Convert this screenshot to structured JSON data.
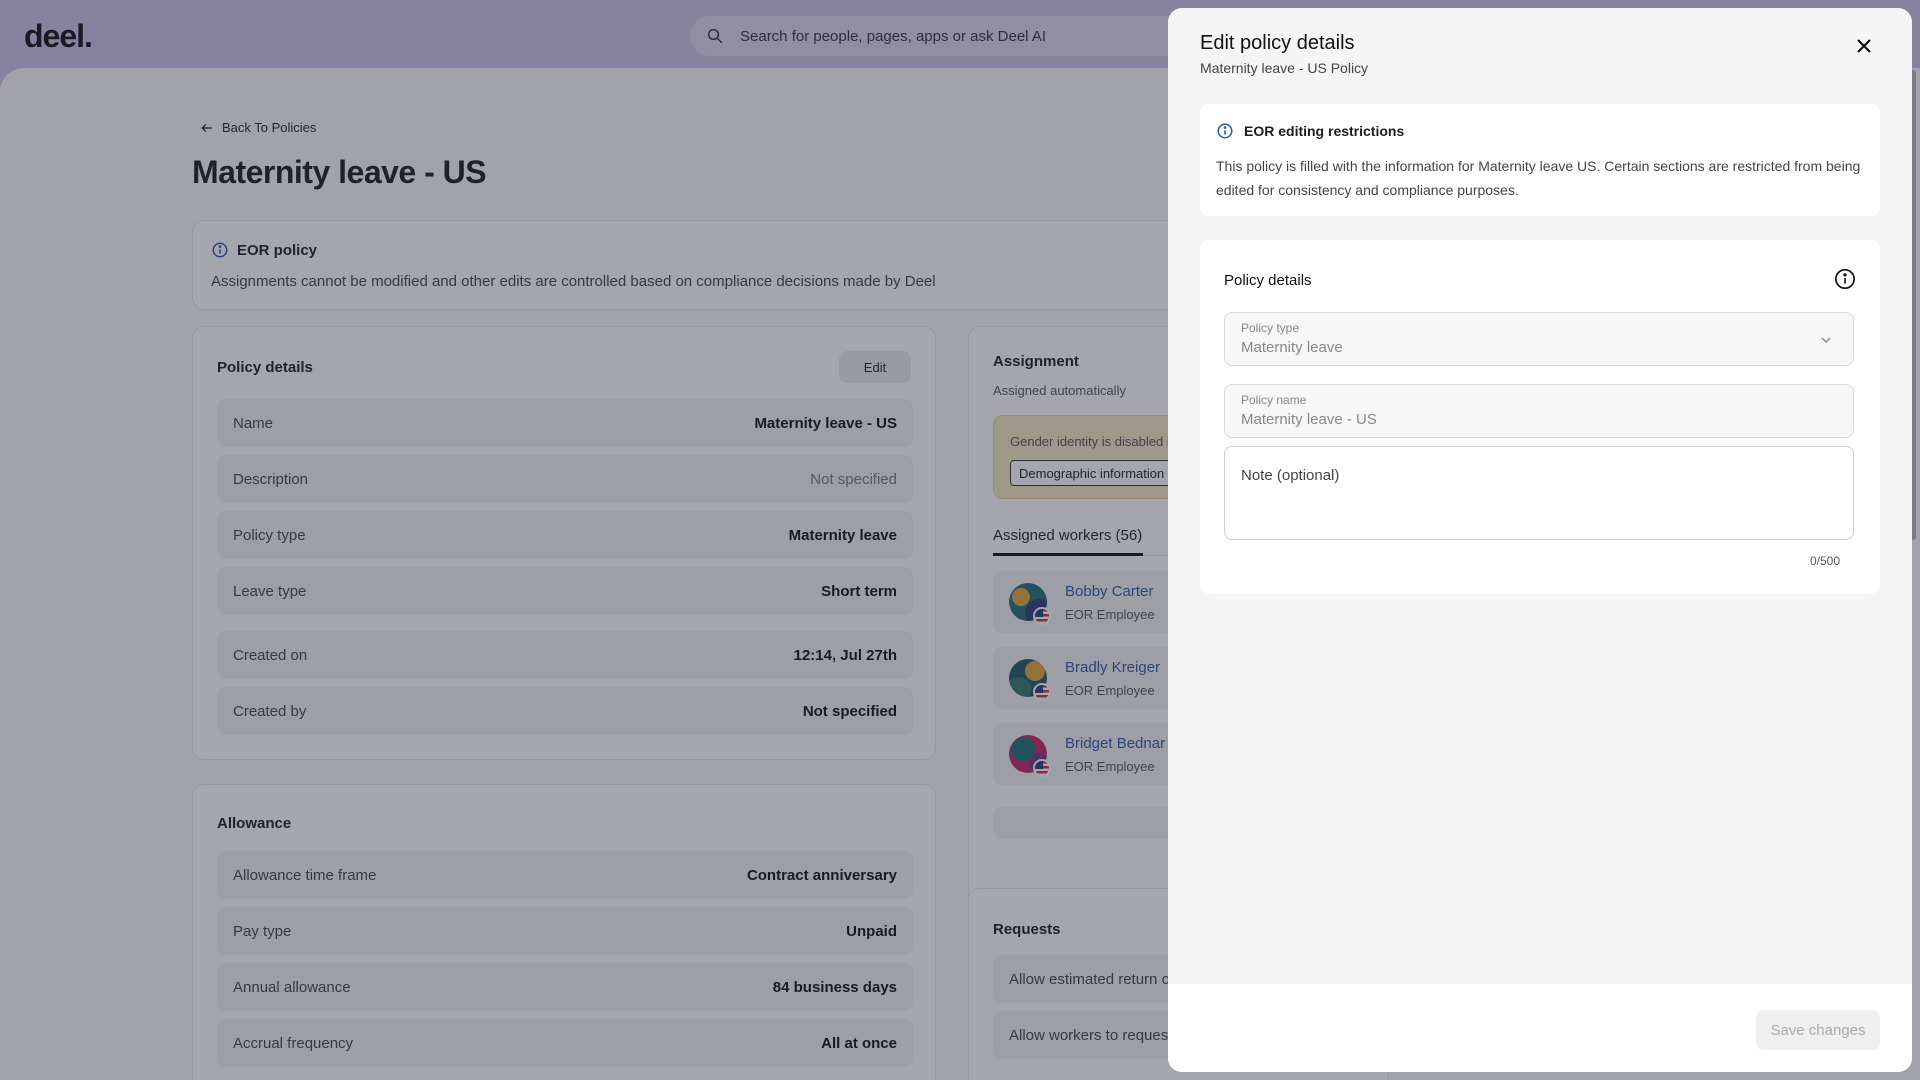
{
  "app": {
    "logo": "deel.",
    "search_placeholder": "Search for people, pages, apps or ask Deel AI"
  },
  "page": {
    "back_label": "Back To Policies",
    "title": "Maternity leave - US",
    "eor_banner": {
      "title": "EOR policy",
      "description": "Assignments cannot be modified and other edits are controlled based on compliance decisions made by Deel"
    },
    "policy_details": {
      "title": "Policy details",
      "edit_label": "Edit",
      "rows": [
        {
          "label": "Name",
          "value": "Maternity leave - US",
          "muted": false
        },
        {
          "label": "Description",
          "value": "Not specified",
          "muted": true
        },
        {
          "label": "Policy type",
          "value": "Maternity leave",
          "muted": false
        },
        {
          "label": "Leave type",
          "value": "Short term",
          "muted": false
        },
        {
          "label": "Created on",
          "value": "12:14, Jul 27th",
          "muted": false
        },
        {
          "label": "Created by",
          "value": "Not specified",
          "muted": false
        }
      ]
    },
    "allowance": {
      "title": "Allowance",
      "rows": [
        {
          "label": "Allowance time frame",
          "value": "Contract anniversary"
        },
        {
          "label": "Pay type",
          "value": "Unpaid"
        },
        {
          "label": "Annual allowance",
          "value": "84 business days"
        },
        {
          "label": "Accrual frequency",
          "value": "All at once"
        }
      ]
    },
    "assignment": {
      "title": "Assignment",
      "subtitle": "Assigned automatically",
      "warning_text": "Gender identity is disabled i",
      "warning_chip": "Demographic information",
      "tab_label": "Assigned workers (56)",
      "workers": [
        {
          "name": "Bobby Carter",
          "role": "EOR Employee"
        },
        {
          "name": "Bradly Kreiger",
          "role": "EOR Employee"
        },
        {
          "name": "Bridget Bednar",
          "role": "EOR Employee"
        }
      ]
    },
    "requests": {
      "title": "Requests",
      "rows": [
        "Allow estimated return c",
        "Allow workers to reques"
      ]
    }
  },
  "drawer": {
    "title": "Edit policy details",
    "subtitle": "Maternity leave - US Policy",
    "restriction": {
      "title": "EOR editing restrictions",
      "body": "This policy is filled with the information for Maternity leave US. Certain sections are restricted from being edited for consistency and compliance purposes."
    },
    "policy_details": {
      "title": "Policy details",
      "policy_type_label": "Policy type",
      "policy_type_value": "Maternity leave",
      "policy_name_label": "Policy name",
      "policy_name_value": "Maternity leave - US",
      "note_placeholder": "Note (optional)",
      "counter": "0/500"
    },
    "save_label": "Save changes"
  },
  "colors": {
    "accent_link": "#2b5aa8",
    "brand_bar": "#cbc3e6",
    "warning_bg": "#f7e9bf"
  }
}
